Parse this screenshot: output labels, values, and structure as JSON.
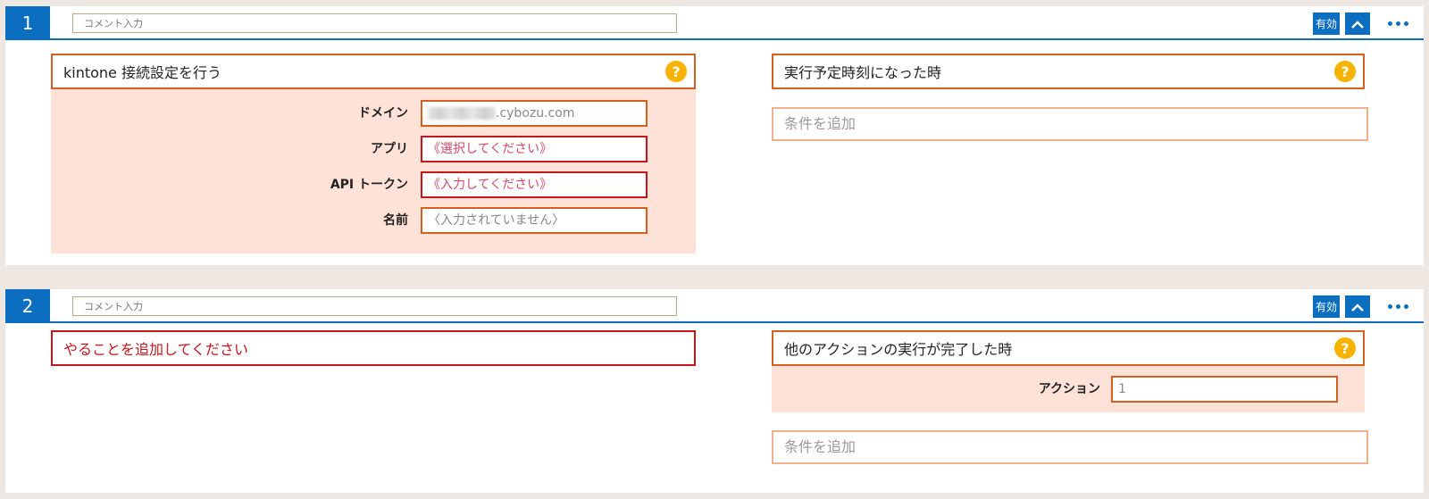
{
  "cards": [
    {
      "number": "1",
      "comment_placeholder": "コメント入力",
      "enabled_label": "有効",
      "action": {
        "title": "kintone 接続設定を行う",
        "help": "?",
        "fields": [
          {
            "label": "ドメイン",
            "value": ".cybozu.com"
          },
          {
            "label": "アプリ",
            "value": "《選択してください》"
          },
          {
            "label": "API トークン",
            "value": "《入力してください》"
          },
          {
            "label": "名前",
            "value": "〈入力されていません〉"
          }
        ]
      },
      "trigger": {
        "title": "実行予定時刻になった時",
        "help": "?",
        "add_condition": "条件を追加"
      }
    },
    {
      "number": "2",
      "comment_placeholder": "コメント入力",
      "enabled_label": "有効",
      "action": {
        "title": "やることを追加してください"
      },
      "trigger": {
        "title": "他のアクションの実行が完了した時",
        "help": "?",
        "fields": [
          {
            "label": "アクション",
            "value": "1"
          }
        ],
        "add_condition": "条件を追加"
      }
    }
  ]
}
